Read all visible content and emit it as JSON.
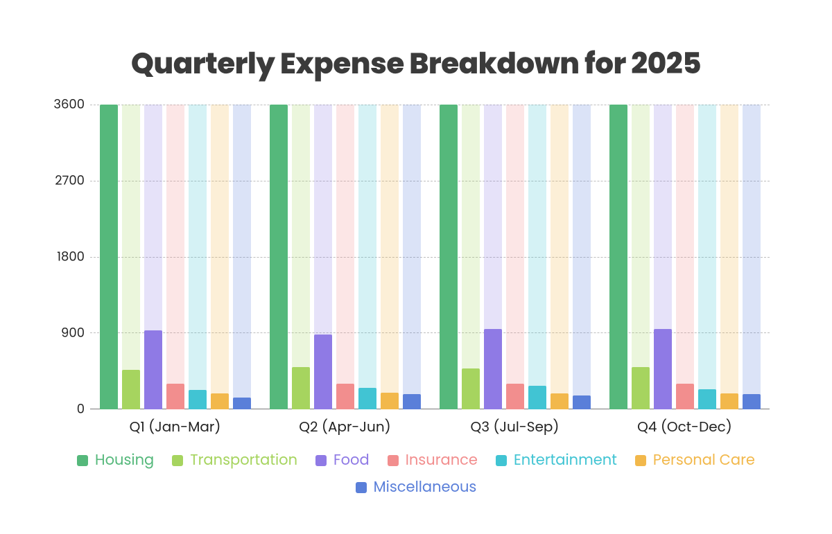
{
  "chart_data": {
    "type": "bar",
    "title": "Quarterly Expense Breakdown for 2025",
    "xlabel": "",
    "ylabel": "",
    "ylim": [
      0,
      3600
    ],
    "y_ticks": [
      0,
      900,
      1800,
      2700,
      3600
    ],
    "categories": [
      "Q1 (Jan-Mar)",
      "Q2 (Apr-Jun)",
      "Q3 (Jul-Sep)",
      "Q4 (Oct-Dec)"
    ],
    "series": [
      {
        "name": "Housing",
        "color": "#55b87b",
        "values": [
          3600,
          3600,
          3600,
          3600
        ]
      },
      {
        "name": "Transportation",
        "color": "#a6d45f",
        "values": [
          470,
          500,
          480,
          500
        ]
      },
      {
        "name": "Food",
        "color": "#8f7ae5",
        "values": [
          930,
          880,
          950,
          950
        ]
      },
      {
        "name": "Insurance",
        "color": "#f28e8e",
        "values": [
          300,
          300,
          300,
          300
        ]
      },
      {
        "name": "Entertainment",
        "color": "#41c4d3",
        "values": [
          230,
          250,
          280,
          240
        ]
      },
      {
        "name": "Personal Care",
        "color": "#f2b84b",
        "values": [
          190,
          200,
          190,
          190
        ]
      },
      {
        "name": "Miscellaneous",
        "color": "#5a7fd9",
        "values": [
          140,
          180,
          160,
          180
        ]
      }
    ],
    "legend_position": "bottom",
    "grid": true
  }
}
